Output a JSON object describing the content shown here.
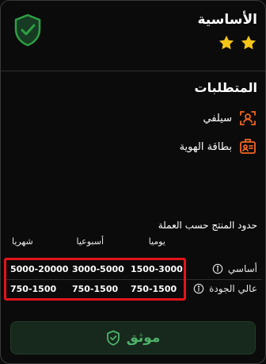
{
  "header": {
    "title": "الأساسية",
    "stars_count": 2,
    "star_color": "#f5c518",
    "badge_color": "#2f9e44"
  },
  "requirements": {
    "title": "المتطلبات",
    "items": [
      {
        "icon": "face-scan-icon",
        "label": "سيلفي"
      },
      {
        "icon": "id-card-icon",
        "label": "بطاقة الهوية"
      }
    ],
    "icon_color": "#f26522"
  },
  "limits": {
    "title": "حدود المنتج حسب العملة",
    "columns": [
      "يوميا",
      "أسبوعيا",
      "شهريا"
    ],
    "rows": [
      {
        "label": "أساسي",
        "values": [
          "1500-3000",
          "3000-5000",
          "5000-20000"
        ]
      },
      {
        "label": "عالي الجودة",
        "values": [
          "750-1500",
          "750-1500",
          "750-1500"
        ]
      }
    ],
    "highlight_color": "#e3141b"
  },
  "action": {
    "label": "موثق",
    "color": "#4fb26b"
  }
}
